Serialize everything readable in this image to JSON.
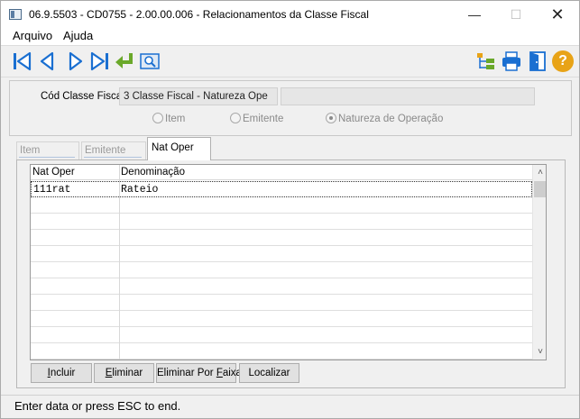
{
  "window": {
    "title": "06.9.5503 - CD0755 - 2.00.00.006 - Relacionamentos da Classe Fiscal"
  },
  "title_buttons": {
    "minimize": "—",
    "maximize": "☐",
    "close": "✕"
  },
  "menu": {
    "items": [
      "Arquivo",
      "Ajuda"
    ]
  },
  "toolbar": {
    "icons": [
      "first-record-icon",
      "previous-record-icon",
      "next-record-icon",
      "last-record-icon",
      "go-to-icon",
      "search-zoom-icon",
      "tree-structure-icon",
      "print-icon",
      "exit-door-icon",
      "help-icon"
    ],
    "help_symbol": "?"
  },
  "header": {
    "cod_label": "Cód Classe Fiscal:",
    "cod_value": "3 Classe Fiscal - Natureza Ope",
    "cod_description": "",
    "radio_options": [
      "Item",
      "Emitente",
      "Natureza de Operação"
    ],
    "radio_selected": "Natureza de Operação"
  },
  "tabs": [
    {
      "label": "Item",
      "active": false
    },
    {
      "label": "Emitente",
      "active": false
    },
    {
      "label": "Nat Oper",
      "active": true
    }
  ],
  "grid": {
    "columns": [
      "Nat Oper",
      "Denominação"
    ],
    "rows": [
      {
        "nat_oper": "111rat",
        "denominacao": "Rateio"
      }
    ],
    "scroll_up": "˄",
    "scroll_down": "˅"
  },
  "buttons": {
    "incluir": {
      "key": "I",
      "rest": "ncluir"
    },
    "eliminar": {
      "key": "E",
      "rest": "liminar"
    },
    "eliminar_faixa": {
      "pre": "Eliminar Por ",
      "key": "F",
      "rest": "aixa"
    },
    "localizar": "Localizar"
  },
  "status": {
    "message": "Enter data or press ESC to end."
  },
  "colors": {
    "nav_blue": "#1a6fd1",
    "green_arrow": "#6aa82a",
    "help_orange": "#e8a317",
    "accent_border": "#b0c4de"
  }
}
